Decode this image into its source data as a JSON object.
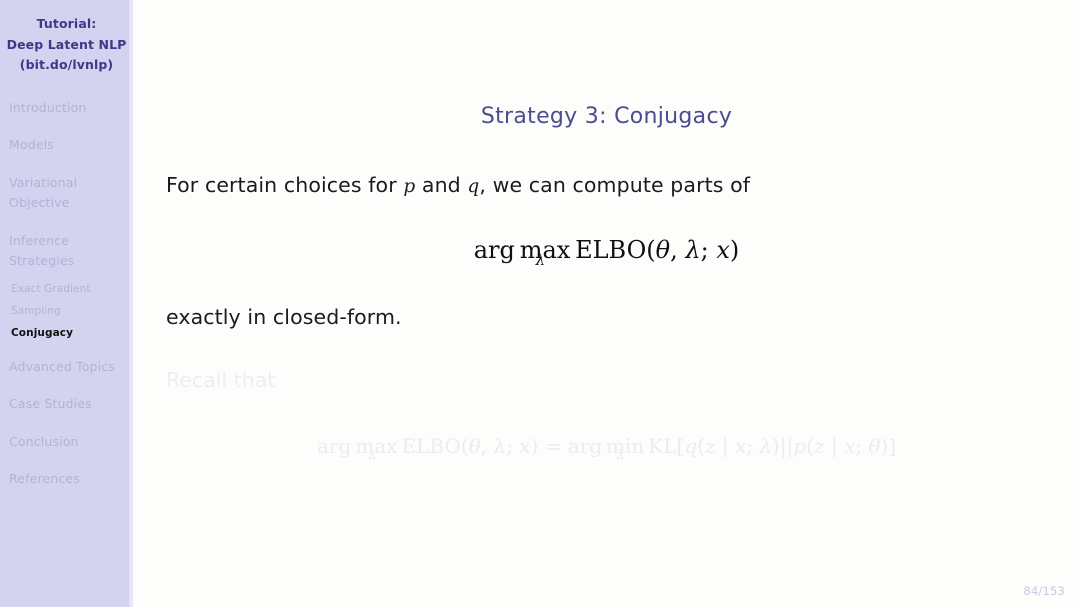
{
  "sidebar": {
    "title_lines": [
      "Tutorial:",
      "Deep Latent NLP",
      "(bit.do/lvnlp)"
    ],
    "sections": [
      {
        "name": "introduction",
        "lines": [
          "Introduction"
        ]
      },
      {
        "name": "models",
        "lines": [
          "Models"
        ]
      },
      {
        "name": "variational-objective",
        "lines": [
          "Variational",
          "Objective"
        ]
      },
      {
        "name": "inference-strategies",
        "lines": [
          "Inference",
          "Strategies"
        ]
      }
    ],
    "subsections": [
      {
        "name": "exact-gradient",
        "label": "Exact Gradient",
        "current": false
      },
      {
        "name": "sampling",
        "label": "Sampling",
        "current": false
      },
      {
        "name": "conjugacy",
        "label": "Conjugacy",
        "current": true
      }
    ],
    "sections_after": [
      {
        "name": "advanced-topics",
        "lines": [
          "Advanced Topics"
        ]
      },
      {
        "name": "case-studies",
        "lines": [
          "Case Studies"
        ]
      },
      {
        "name": "conclusion",
        "lines": [
          "Conclusion"
        ]
      },
      {
        "name": "references",
        "lines": [
          "References"
        ]
      }
    ]
  },
  "slide": {
    "title": "Strategy 3: Conjugacy",
    "intro": {
      "part1": "For certain choices for ",
      "var_p": "p",
      "part2": " and ",
      "var_q": "q",
      "part3": ", we can compute parts of"
    },
    "equation_main": {
      "arg": "arg",
      "max": "max",
      "sub": "λ",
      "body": "ELBO(",
      "theta": "θ",
      "comma": ", ",
      "lambda": "λ",
      "semi": "; ",
      "x": "x",
      "close": ")"
    },
    "closed_form": "exactly in closed-form.",
    "recall_label": "Recall that",
    "equation_recall": {
      "arg1": "arg",
      "max": "max",
      "sub1": "λ",
      "lhs_body": "ELBO(",
      "theta1": "θ",
      "comma1": ", ",
      "lambda1": "λ",
      "semi1": "; ",
      "x1": "x",
      "close1": ")",
      "equals": " = ",
      "arg2": "arg",
      "min": "min",
      "sub2": "λ",
      "kl": "KL[",
      "q": "q",
      "qopen": "(",
      "z1": "z",
      "bar1": " | ",
      "x2": "x",
      "semi2": "; ",
      "lambda2": "λ",
      "qclose": ")",
      "dbar": "||",
      "p": "p",
      "popen": "(",
      "z2": "z",
      "bar2": " | ",
      "x3": "x",
      "semi3": "; ",
      "theta2": "θ",
      "pclose": ")]"
    },
    "page_number": "84/153"
  },
  "colors": {
    "sidebar_bg": "#d4d3ef",
    "sidebar_title": "#3b3b8a",
    "sidebar_item": "#b2b1d9",
    "sidebar_current": "#111111",
    "slide_title": "#4c4c8f",
    "body_text": "#1b1b1b",
    "faded_text": "#ececed",
    "page_number": "#c9c8e2",
    "content_bg": "#fdfdfc"
  }
}
